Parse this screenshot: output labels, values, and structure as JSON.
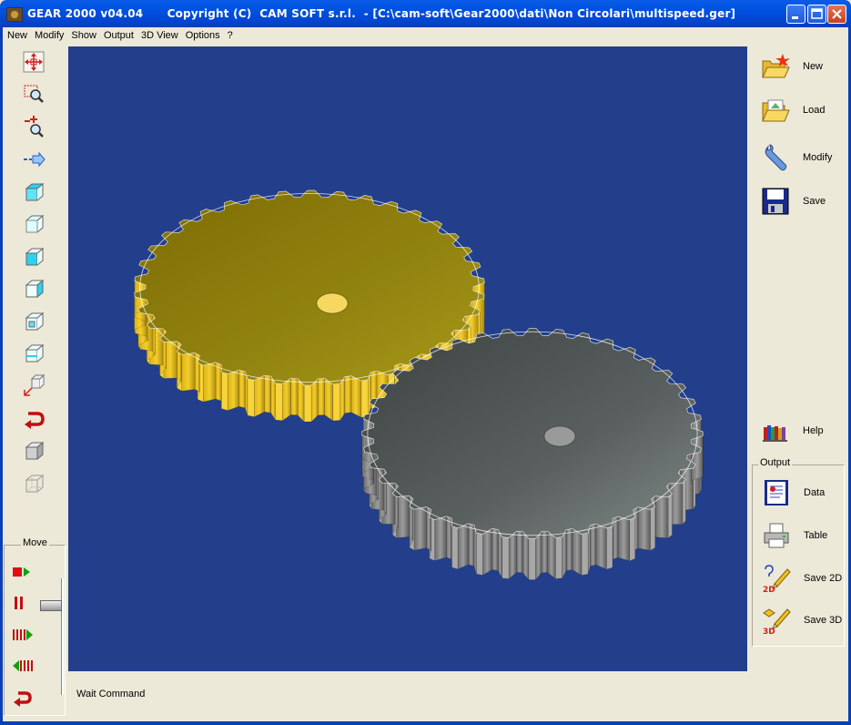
{
  "window": {
    "title": "GEAR 2000 v04.04      Copyright (C)  CAM SOFT s.r.l.  - [C:\\cam-soft\\Gear2000\\dati\\Non Circolari\\multispeed.ger]"
  },
  "menu": [
    "New",
    "Modify",
    "Show",
    "Output",
    "3D View",
    "Options",
    "?"
  ],
  "left_toolbar": {
    "tools": [
      "pan-icon",
      "zoom-window-icon",
      "zoom-in-out-icon",
      "redraw-arrow-icon",
      "view-top-icon",
      "view-front-icon",
      "view-left-icon",
      "view-right-icon",
      "view-iso-icon",
      "view-back-icon",
      "rotate-axes-icon",
      "undo-icon",
      "shaded-box-icon",
      "wireframe-box-icon"
    ]
  },
  "move_panel": {
    "label": "Move",
    "slider_level": 0.5
  },
  "right_panel": {
    "new": "New",
    "load": "Load",
    "modify": "Modify",
    "save": "Save",
    "help": "Help"
  },
  "output_panel": {
    "label": "Output",
    "data": "Data",
    "table": "Table",
    "save2d": "Save 2D",
    "save3d": "Save 3D",
    "save2d_badge": "2D",
    "save3d_badge": "3D"
  },
  "status": {
    "text": "Wait Command"
  },
  "colors": {
    "viewport_bg": "#233F8C",
    "gear_yellow": "#8A7A10",
    "gear_gray": "#5A5E5E"
  }
}
